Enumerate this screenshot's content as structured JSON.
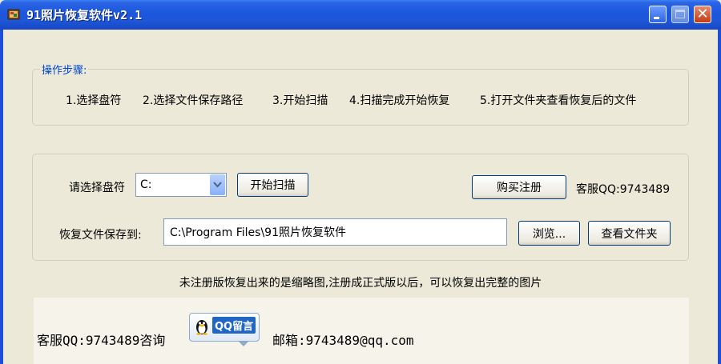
{
  "window": {
    "title": "91照片恢复软件v2.1",
    "controls": {
      "minimize_icon": "minimize-icon",
      "maximize_icon": "maximize-icon",
      "close_glyph": "✕"
    }
  },
  "steps": {
    "legend": "操作步骤:",
    "items": [
      "1.选择盘符",
      "2.选择文件保存路径",
      "3.开始扫描",
      "4.扫描完成开始恢复",
      "5.打开文件夹查看恢复后的文件"
    ]
  },
  "scan": {
    "drive_label": "请选择盘符",
    "drive_value": "C:",
    "start_scan_label": "开始扫描",
    "buy_register_label": "购买注册",
    "support_qq": "客服QQ:9743489",
    "save_to_label": "恢复文件保存到:",
    "save_path_value": "C:\\Program Files\\91照片恢复软件",
    "browse_label": "浏览...",
    "view_folder_label": "查看文件夹"
  },
  "notice": "未注册版恢复出来的是缩略图,注册成正式版以后，可以恢复出完整的图片",
  "footer": {
    "consult_text": "客服QQ:9743489咨询",
    "qq_message_label": "QQ留言",
    "email_text": "邮箱:9743489@qq.com"
  },
  "colors": {
    "titlebar": "#1b56dc",
    "background": "#ece9d8",
    "legend": "#0046d5",
    "close_button": "#c43b14"
  }
}
